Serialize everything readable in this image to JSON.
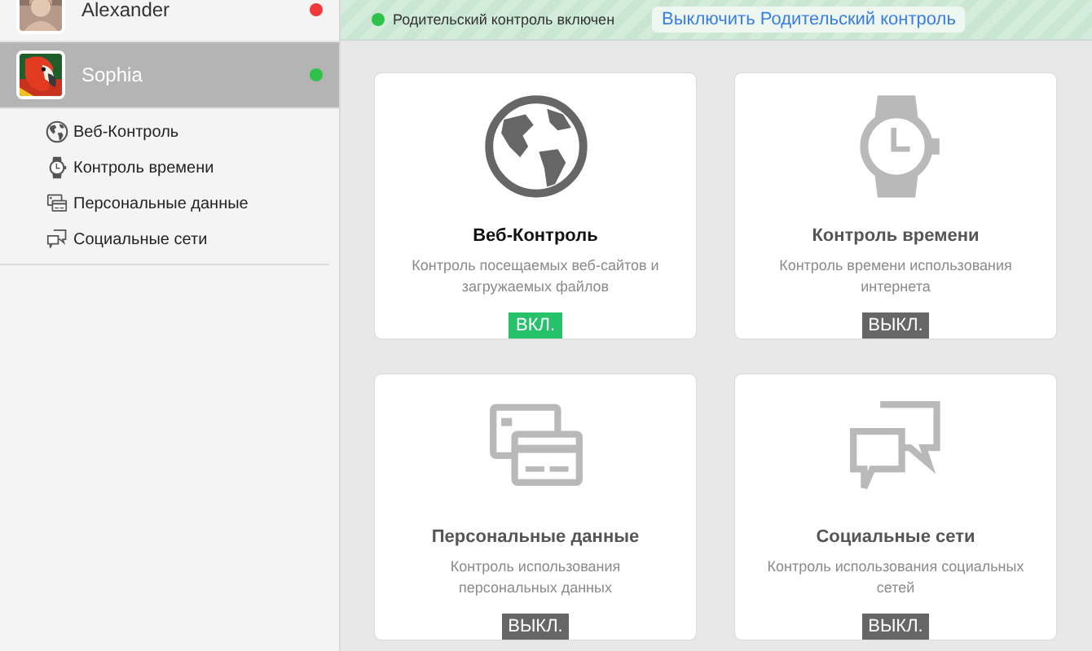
{
  "users": [
    {
      "name": "Alexander",
      "color": "#f0393d",
      "selected": false
    },
    {
      "name": "Sophia",
      "color": "#2fc24a",
      "selected": true,
      "children": [
        {
          "kind": "web",
          "label": "Веб-Контроль"
        },
        {
          "kind": "time",
          "label": "Контроль времени"
        },
        {
          "kind": "personal",
          "label": "Персональные данные"
        },
        {
          "kind": "social",
          "label": "Социальные сети"
        }
      ]
    }
  ],
  "status_bar": {
    "on": true,
    "text": "Родительский контроль включен",
    "button": "Выключить Родительский контроль"
  },
  "cards": [
    {
      "kind": "web",
      "title": "Веб-Контроль",
      "description": "Контроль посещаемых веб-сайтов и загружаемых файлов",
      "on": true,
      "badge": "ВКЛ."
    },
    {
      "kind": "time",
      "title": "Контроль времени",
      "description": "Контроль времени использования интернета",
      "on": false,
      "badge": "ВЫКЛ."
    },
    {
      "kind": "personal",
      "title": "Персональные данные",
      "description": "Контроль использования персональных данных",
      "on": false,
      "badge": "ВЫКЛ."
    },
    {
      "kind": "social",
      "title": "Социальные сети",
      "description": "Контроль использования социальных сетей",
      "on": false,
      "badge": "ВЫКЛ."
    }
  ]
}
